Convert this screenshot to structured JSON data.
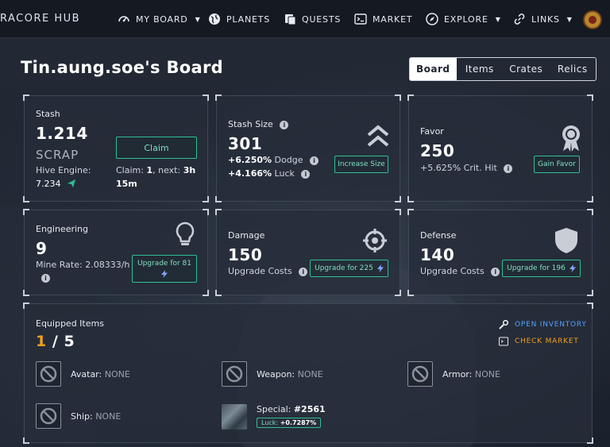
{
  "nav": {
    "brand": "RACORE HUB",
    "items": [
      {
        "label": "MY BOARD",
        "icon": "gauge-icon",
        "caret": true
      },
      {
        "label": "PLANETS",
        "icon": "globe-icon",
        "caret": false
      },
      {
        "label": "QUESTS",
        "icon": "scroll-icon",
        "caret": false
      },
      {
        "label": "MARKET",
        "icon": "terminal-icon",
        "caret": false
      },
      {
        "label": "EXPLORE",
        "icon": "compass-icon",
        "caret": true
      },
      {
        "label": "LINKS",
        "icon": "link-icon",
        "caret": true
      }
    ],
    "caret_glyph": "▼"
  },
  "page_title": "Tin.aung.soe's Board",
  "tabs": [
    "Board",
    "Items",
    "Crates",
    "Relics"
  ],
  "active_tab": "Board",
  "stash": {
    "label": "Stash",
    "value": "1.214",
    "unit": "SCRAP",
    "hive_label": "Hive Engine:",
    "hive_value": "7.234",
    "claim_button": "Claim",
    "claim_label": "Claim:",
    "claim_count": "1",
    "next_label": ", next:",
    "next_value": "3h",
    "next_value2": "15m"
  },
  "stash_size": {
    "label": "Stash Size",
    "value": "301",
    "dodge_value": "+6.250%",
    "dodge_label": "Dodge",
    "luck_value": "+4.166%",
    "luck_label": "Luck",
    "button": "Increase Size"
  },
  "favor": {
    "label": "Favor",
    "value": "250",
    "bonus": "+5.625% Crit. Hit",
    "button": "Gain Favor"
  },
  "engineering": {
    "label": "Engineering",
    "value": "9",
    "rate": "Mine Rate: 2.08333/h",
    "button": "Upgrade for 81"
  },
  "damage": {
    "label": "Damage",
    "value": "150",
    "costs_label": "Upgrade Costs",
    "button": "Upgrade for 225"
  },
  "defense": {
    "label": "Defense",
    "value": "140",
    "costs_label": "Upgrade Costs",
    "button": "Upgrade for 196"
  },
  "equipped": {
    "label": "Equipped Items",
    "count": "1",
    "separator": "/",
    "total": "5",
    "open_inventory": "OPEN INVENTORY",
    "check_market": "CHECK MARKET",
    "slots": {
      "avatar": {
        "label": "Avatar:",
        "value": "NONE"
      },
      "weapon": {
        "label": "Weapon:",
        "value": "NONE"
      },
      "armor": {
        "label": "Armor:",
        "value": "NONE"
      },
      "ship": {
        "label": "Ship:",
        "value": "NONE"
      },
      "special": {
        "label": "Special:",
        "value": "#2561",
        "luck_label": "Luck:",
        "luck_value": "+0.7287%"
      }
    }
  },
  "colors": {
    "accent_green": "#2fbf94",
    "count_orange": "#f0a020",
    "link_blue": "#4da3ff",
    "link_orange": "#f0a020"
  }
}
